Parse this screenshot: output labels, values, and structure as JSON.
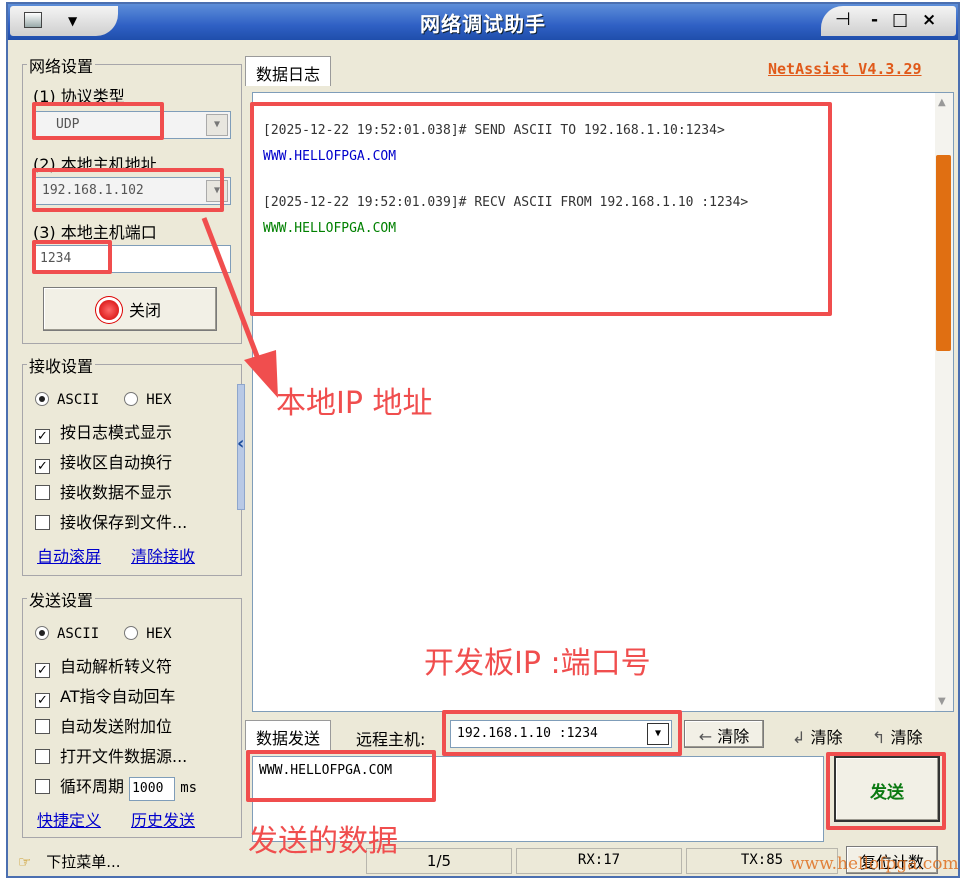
{
  "window": {
    "title": "网络调试助手",
    "controls": "- □ ×"
  },
  "left": {
    "network": {
      "title": "网络设置",
      "protocol_label": "(1) 协议类型",
      "protocol_value": "UDP",
      "host_label": "(2) 本地主机地址",
      "host_value": "192.168.1.102",
      "port_label": "(3) 本地主机端口",
      "port_value": "1234",
      "close_button": "关闭"
    },
    "receive": {
      "title": "接收设置",
      "ascii": "ASCII",
      "hex": "HEX",
      "options": [
        "按日志模式显示",
        "接收区自动换行",
        "接收数据不显示",
        "接收保存到文件..."
      ],
      "checked": [
        true,
        true,
        false,
        false
      ],
      "link_auto_scroll": "自动滚屏",
      "link_clear": "清除接收"
    },
    "send": {
      "title": "发送设置",
      "ascii": "ASCII",
      "hex": "HEX",
      "options": [
        "自动解析转义符",
        "AT指令自动回车",
        "自动发送附加位",
        "打开文件数据源..."
      ],
      "checked": [
        true,
        true,
        false,
        false
      ],
      "cycle_label": "循环周期",
      "cycle_value": "1000",
      "cycle_unit": "ms",
      "link_shortcut": "快捷定义",
      "link_history": "历史发送"
    }
  },
  "log": {
    "tab": "数据日志",
    "version": "NetAssist V4.3.29",
    "entries": [
      {
        "header": "[2025-12-22 19:52:01.038]# SEND ASCII TO 192.168.1.10:1234>",
        "body": "WWW.HELLOFPGA.COM",
        "color": "#0000cc"
      },
      {
        "header": "[2025-12-22 19:52:01.039]# RECV ASCII FROM 192.168.1.10 :1234>",
        "body": "WWW.HELLOFPGA.COM",
        "color": "#008000"
      }
    ]
  },
  "send_bar": {
    "tab": "数据发送",
    "remote_label": "远程主机:",
    "remote_value": "192.168.1.10 :1234",
    "clear1": "清除",
    "clear2": "清除",
    "clear3": "清除",
    "send_text": "WWW.HELLOFPGA.COM",
    "send_button": "发送"
  },
  "status": {
    "menu": "下拉菜单...",
    "pages": "1/5",
    "rx": "RX:17",
    "tx": "TX:85",
    "reset": "复位计数"
  },
  "annotations": {
    "local_ip": "本地IP 地址",
    "board_ip": "开发板IP :端口号",
    "send_data": "发送的数据",
    "color": "#f04e4e"
  },
  "watermark": "www.hellofpga.com"
}
